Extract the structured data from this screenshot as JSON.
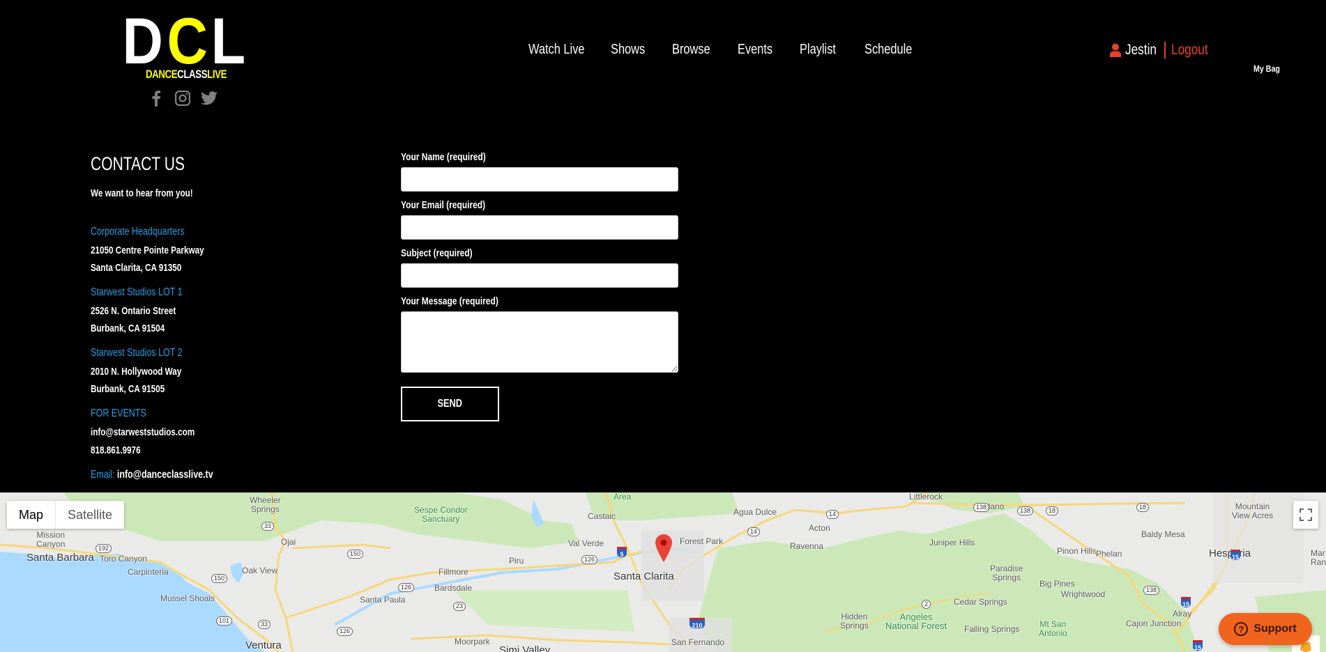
{
  "brand": {
    "logo_top": [
      "D",
      "C",
      "L"
    ],
    "logo_bottom": [
      "DANCE",
      "CLASS",
      "LIVE"
    ],
    "accent_yellow": "#ffff00"
  },
  "social": [
    {
      "name": "facebook",
      "icon": "facebook-icon"
    },
    {
      "name": "instagram",
      "icon": "instagram-icon"
    },
    {
      "name": "twitter",
      "icon": "twitter-icon"
    }
  ],
  "nav": {
    "items": [
      {
        "label": "Watch Live"
      },
      {
        "label": "Shows"
      },
      {
        "label": "Browse"
      },
      {
        "label": "Events"
      },
      {
        "label": "Playlist"
      },
      {
        "label": "Schedule"
      }
    ]
  },
  "user": {
    "icon": "user-icon",
    "name": "Jestin",
    "logout_label": "Logout",
    "accent": "#e8402a",
    "bag_label": "My Bag"
  },
  "contact": {
    "title": "CONTACT US",
    "intro": "We want to hear from you!",
    "accent_blue": "#1fa0e6",
    "locations": [
      {
        "heading": "Corporate Headquarters",
        "lines": [
          "21050 Centre Pointe Parkway",
          "Santa Clarita, CA 91350"
        ]
      },
      {
        "heading": "Starwest Studios LOT 1",
        "lines": [
          "2526 N. Ontario Street",
          "Burbank, CA 91504"
        ]
      },
      {
        "heading": "Starwest Studios LOT 2",
        "lines": [
          "2010 N. Hollywood Way",
          "Burbank, CA 91505"
        ]
      },
      {
        "heading": "FOR EVENTS",
        "lines": [
          "info@starweststudios.com",
          "818.861.9976"
        ]
      }
    ],
    "email_label": "Email:",
    "email_value": "info@danceclasslive.tv"
  },
  "form": {
    "fields": [
      {
        "label": "Your Name (required)",
        "value": "",
        "placeholder": ""
      },
      {
        "label": "Your Email (required)",
        "value": "",
        "placeholder": ""
      },
      {
        "label": "Subject (required)",
        "value": "",
        "placeholder": ""
      },
      {
        "label": "Your Message (required)",
        "value": "",
        "placeholder": ""
      }
    ],
    "send_label": "SEND"
  },
  "map": {
    "type_buttons": [
      {
        "label": "Map",
        "active": true
      },
      {
        "label": "Satellite",
        "active": false
      }
    ],
    "labels": [
      {
        "text": "Wheeler\nSprings",
        "kind": "town"
      },
      {
        "text": "Sespe Condor\nSanctuary",
        "kind": "park"
      },
      {
        "text": "Area",
        "kind": "park"
      },
      {
        "text": "Littlerock",
        "kind": "town"
      },
      {
        "text": "Llano",
        "kind": "town"
      },
      {
        "text": "Mountain\nView Acres",
        "kind": "town"
      },
      {
        "text": "Mission\nCanyon",
        "kind": "town"
      },
      {
        "text": "Castaic",
        "kind": "town"
      },
      {
        "text": "Agua Dulce",
        "kind": "town"
      },
      {
        "text": "Acton",
        "kind": "town"
      },
      {
        "text": "Baldy Mesa",
        "kind": "town"
      },
      {
        "text": "Santa Barbara",
        "kind": "city"
      },
      {
        "text": "Toro Canyon",
        "kind": "town"
      },
      {
        "text": "Ojai",
        "kind": "town"
      },
      {
        "text": "Val Verde",
        "kind": "town"
      },
      {
        "text": "Forest Park",
        "kind": "town"
      },
      {
        "text": "Ravenna",
        "kind": "town"
      },
      {
        "text": "Juniper Hills",
        "kind": "town"
      },
      {
        "text": "Pinon Hills",
        "kind": "town"
      },
      {
        "text": "Phelan",
        "kind": "town"
      },
      {
        "text": "Hesperia",
        "kind": "city"
      },
      {
        "text": "Carpinteria",
        "kind": "town"
      },
      {
        "text": "Oak View",
        "kind": "town"
      },
      {
        "text": "Piru",
        "kind": "town"
      },
      {
        "text": "Fillmore",
        "kind": "town"
      },
      {
        "text": "Santa Clarita",
        "kind": "city"
      },
      {
        "text": "Paradise\nSprings",
        "kind": "town"
      },
      {
        "text": "Bardsdale",
        "kind": "town"
      },
      {
        "text": "Big Pines",
        "kind": "town"
      },
      {
        "text": "Wrightwood",
        "kind": "town"
      },
      {
        "text": "Mussel Shoals",
        "kind": "town"
      },
      {
        "text": "Santa Paula",
        "kind": "town"
      },
      {
        "text": "Cedar Springs",
        "kind": "town"
      },
      {
        "text": "Alray",
        "kind": "town"
      },
      {
        "text": "Hidden\nSprings",
        "kind": "town"
      },
      {
        "text": "Angeles\nNational Forest",
        "kind": "park"
      },
      {
        "text": "Mt San\nAntonio",
        "kind": "park"
      },
      {
        "text": "Falling Springs",
        "kind": "town"
      },
      {
        "text": "Cajon Junction",
        "kind": "town"
      },
      {
        "text": "Ventura",
        "kind": "city"
      },
      {
        "text": "Moorpark",
        "kind": "town"
      },
      {
        "text": "Simi Valley",
        "kind": "city"
      },
      {
        "text": "San Fernando",
        "kind": "town"
      }
    ],
    "shields": [
      "33",
      "192",
      "150",
      "138",
      "138",
      "18",
      "14",
      "14",
      "18",
      "126",
      "126",
      "101",
      "33",
      "23",
      "126",
      "2",
      "138"
    ],
    "interstates": [
      "5",
      "15",
      "210",
      "15",
      "15"
    ],
    "fullscreen_icon": "fullscreen-icon",
    "pegman_icon": "pegman-icon",
    "pin_icon": "map-pin-icon"
  },
  "support": {
    "label": "Support",
    "icon": "help-circle-icon",
    "color": "#f0641e"
  }
}
